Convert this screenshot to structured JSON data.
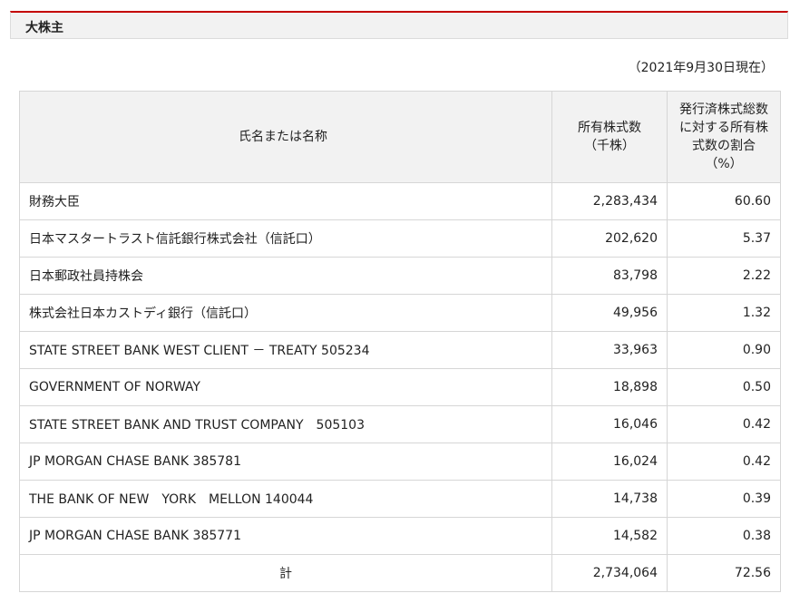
{
  "section": {
    "title": "大株主"
  },
  "as_of": "（2021年9月30日現在）",
  "table": {
    "headers": {
      "name": "氏名または名称",
      "shares_line1": "所有株式数",
      "shares_line2": "（千株）",
      "ratio_line1": "発行済株式総数",
      "ratio_line2": "に対する所有株",
      "ratio_line3": "式数の割合",
      "ratio_line4": "（%）"
    },
    "rows": [
      {
        "name": "財務大臣",
        "shares": "2,283,434",
        "ratio": "60.60"
      },
      {
        "name": "日本マスタートラスト信託銀行株式会社（信託口）",
        "shares": "202,620",
        "ratio": "5.37"
      },
      {
        "name": "日本郵政社員持株会",
        "shares": "83,798",
        "ratio": "2.22"
      },
      {
        "name": "株式会社日本カストディ銀行（信託口）",
        "shares": "49,956",
        "ratio": "1.32"
      },
      {
        "name": "STATE STREET BANK WEST CLIENT － TREATY 505234",
        "shares": "33,963",
        "ratio": "0.90"
      },
      {
        "name": "GOVERNMENT OF NORWAY",
        "shares": "18,898",
        "ratio": "0.50"
      },
      {
        "name": "STATE STREET BANK AND TRUST COMPANY　505103",
        "shares": "16,046",
        "ratio": "0.42"
      },
      {
        "name": "JP MORGAN CHASE BANK 385781",
        "shares": "16,024",
        "ratio": "0.42"
      },
      {
        "name": "THE BANK OF NEW　YORK　MELLON 140044",
        "shares": "14,738",
        "ratio": "0.39"
      },
      {
        "name": "JP MORGAN CHASE BANK 385771",
        "shares": "14,582",
        "ratio": "0.38"
      }
    ],
    "total": {
      "label": "計",
      "shares": "2,734,064",
      "ratio": "72.56"
    }
  },
  "colors": {
    "accent": "#c40000",
    "header_bg": "#f2f2f2",
    "border": "#d6d6d6"
  }
}
